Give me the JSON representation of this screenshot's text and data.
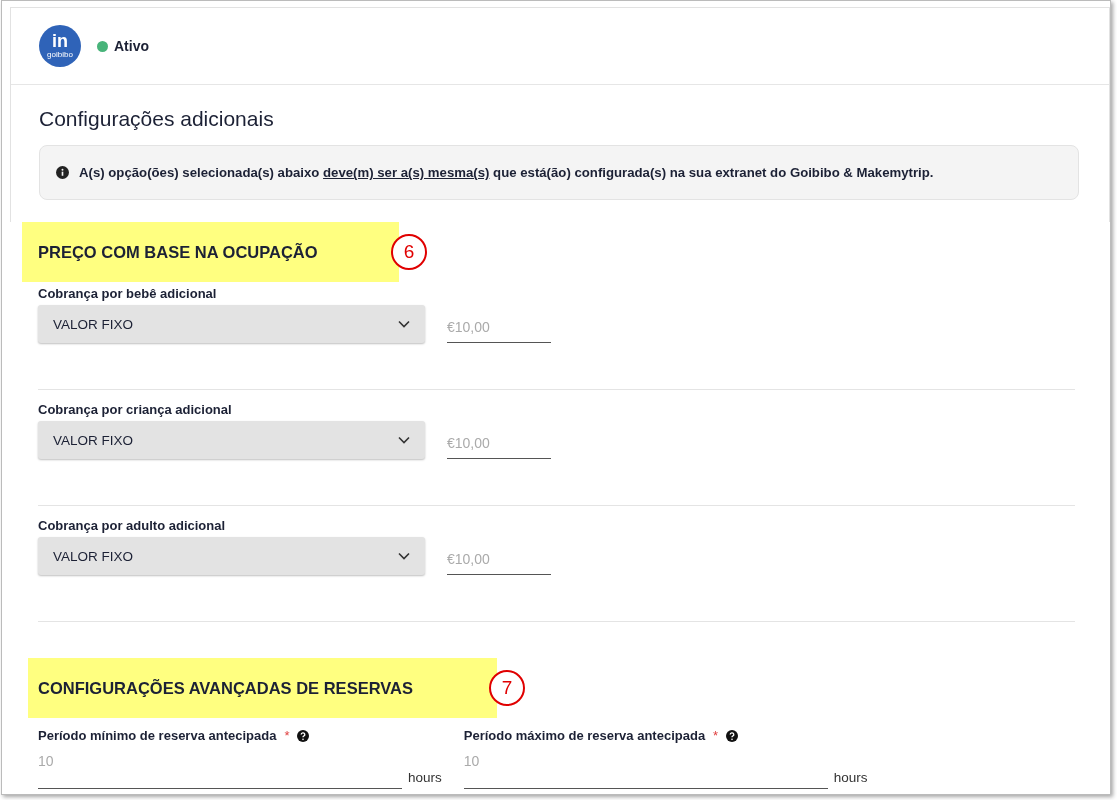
{
  "header": {
    "logo": {
      "letters": "in",
      "caption": "goibibo"
    },
    "status": {
      "label": "Ativo",
      "color": "#48b47a"
    }
  },
  "title": "Configurações adicionais",
  "notice": {
    "before": "A(s) opção(ões) selecionada(s) abaixo ",
    "underlined": "deve(m) ser a(s) mesma(s)",
    "after": " que está(ão) configurada(s) na sua extranet do Goibibo & Makemytrip."
  },
  "sections": [
    {
      "kind": "charges",
      "heading": "PREÇO COM BASE NA OCUPAÇÃO",
      "callout": "6",
      "rows": [
        {
          "label": "Cobrança por bebê adicional",
          "select": "VALOR FIXO",
          "placeholder": "€10,00"
        },
        {
          "label": "Cobrança por criança adicional",
          "select": "VALOR FIXO",
          "placeholder": "€10,00"
        },
        {
          "label": "Cobrança por adulto adicional",
          "select": "VALOR FIXO",
          "placeholder": "€10,00"
        }
      ]
    },
    {
      "kind": "periods",
      "heading": "CONFIGURAÇÕES AVANÇADAS DE RESERVAS",
      "callout": "7",
      "fields": [
        {
          "label": "Período mínimo de reserva antecipada",
          "required_mark": "*",
          "placeholder": "10",
          "unit": "hours"
        },
        {
          "label": "Período máximo de reserva antecipada",
          "required_mark": "*",
          "placeholder": "10",
          "unit": "hours"
        }
      ]
    }
  ]
}
